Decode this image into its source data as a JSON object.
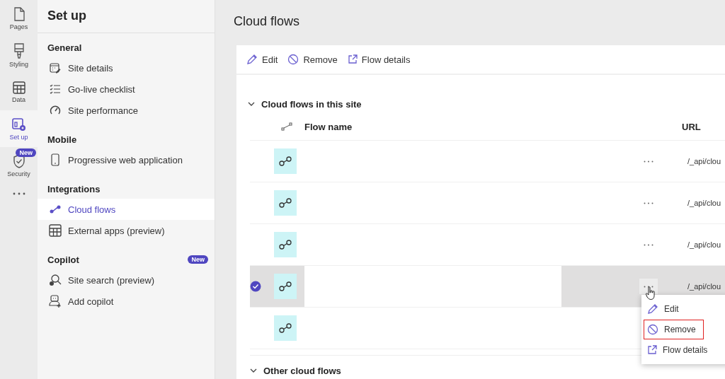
{
  "rail": {
    "items": [
      {
        "label": "Pages",
        "selected": false
      },
      {
        "label": "Styling",
        "selected": false
      },
      {
        "label": "Data",
        "selected": false
      },
      {
        "label": "Set up",
        "selected": true
      },
      {
        "label": "Security",
        "selected": false,
        "badge": "New"
      }
    ]
  },
  "setup_panel": {
    "title": "Set up",
    "sections": [
      {
        "heading": "General",
        "items": [
          {
            "label": "Site details",
            "selected": false
          },
          {
            "label": "Go-live checklist",
            "selected": false
          },
          {
            "label": "Site performance",
            "selected": false
          }
        ]
      },
      {
        "heading": "Mobile",
        "items": [
          {
            "label": "Progressive web application",
            "selected": false
          }
        ]
      },
      {
        "heading": "Integrations",
        "items": [
          {
            "label": "Cloud flows",
            "selected": true
          },
          {
            "label": "External apps (preview)",
            "selected": false
          }
        ]
      },
      {
        "heading": "Copilot",
        "badge": "New",
        "items": [
          {
            "label": "Site search (preview)",
            "selected": false
          },
          {
            "label": "Add copilot",
            "selected": false
          }
        ]
      }
    ]
  },
  "main": {
    "title": "Cloud flows",
    "toolbar": [
      "Edit",
      "Remove",
      "Flow details"
    ],
    "sections": [
      {
        "label": "Cloud flows in this site",
        "expanded": true,
        "columns": [
          "Flow name",
          "URL"
        ],
        "rows": [
          {
            "selected": false,
            "url": "/_api/clou"
          },
          {
            "selected": false,
            "url": "/_api/clou"
          },
          {
            "selected": false,
            "url": "/_api/clou"
          },
          {
            "selected": true,
            "url": "/_api/clou"
          },
          {
            "selected": false
          }
        ]
      },
      {
        "label": "Other cloud flows",
        "expanded": true
      }
    ]
  },
  "context_menu": {
    "items": [
      {
        "label": "Edit",
        "highlighted": false
      },
      {
        "label": "Remove",
        "highlighted": true
      },
      {
        "label": "Flow details",
        "highlighted": false
      }
    ]
  }
}
